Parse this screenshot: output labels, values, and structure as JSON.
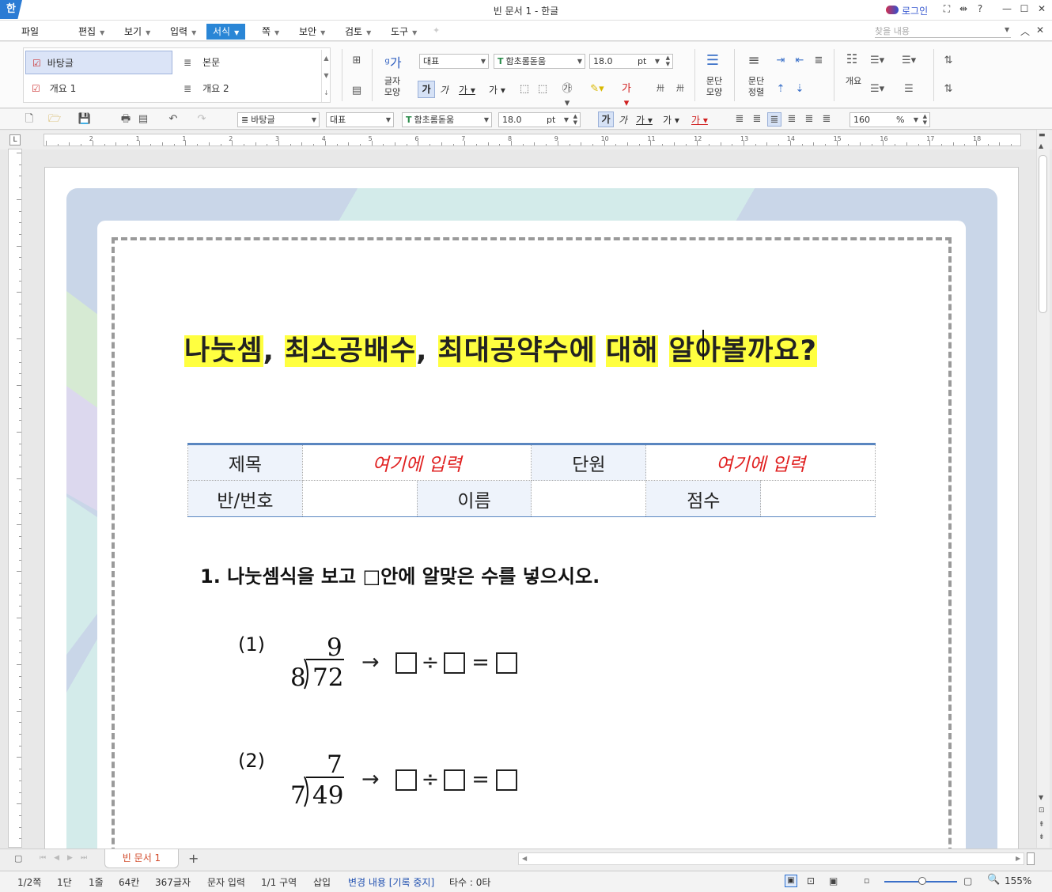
{
  "window": {
    "app_logo": "한",
    "title": "빈 문서 1 - 한글",
    "login": "로그인",
    "buttons": [
      "⛶",
      "⇹",
      "?",
      "—",
      "☐",
      "✕"
    ]
  },
  "menu": {
    "items": [
      "파일",
      "편집",
      "보기",
      "입력",
      "서식",
      "쪽",
      "보안",
      "검토",
      "도구"
    ],
    "active": "서식",
    "search_placeholder": "찾을 내용"
  },
  "ribbon": {
    "styles": [
      "바탕글",
      "본문",
      "개요 1",
      "개요 2"
    ],
    "char_shape_label": "글자 모양",
    "lang_value": "대표",
    "font_value": "함초롬돋움",
    "size_value": "18.0",
    "size_unit": "pt",
    "para_shape_label": "문단 모양",
    "para_align_label": "문단 정렬",
    "outline_label": "개요"
  },
  "toolbar": {
    "style_value": "바탕글",
    "lang_value": "대표",
    "font_value": "함초롬돋움",
    "size_value": "18.0",
    "size_unit": "pt",
    "zoom_value": "160",
    "zoom_unit": "%"
  },
  "ruler": {
    "numbers": [
      "2",
      "1",
      "1",
      "2",
      "3",
      "4",
      "5",
      "6",
      "7",
      "8",
      "9",
      "10",
      "11",
      "12",
      "13",
      "14",
      "15",
      "16",
      "17",
      "18"
    ]
  },
  "document": {
    "title_parts": [
      "나눗셈",
      ", ",
      "최소공배수",
      ", ",
      "최대공약수에",
      " ",
      "대해",
      " ",
      "알아볼까요?"
    ],
    "table": {
      "row1": {
        "h1": "제목",
        "v1": "여기에 입력",
        "h2": "단원",
        "v2": "여기에 입력"
      },
      "row2": {
        "h1": "반/번호",
        "h2": "이름",
        "h3": "점수"
      }
    },
    "question1": "1. 나눗셈식을 보고 □안에 알맞은 수를 넣으시오.",
    "problems": [
      {
        "label": "(1)",
        "quotient": "9",
        "divisor": "8",
        "dividend": "72",
        "arrow": "→",
        "div": "÷",
        "eq": "="
      },
      {
        "label": "(2)",
        "quotient": "7",
        "divisor": "7",
        "dividend": "49",
        "arrow": "→",
        "div": "÷",
        "eq": "="
      }
    ]
  },
  "tabs": {
    "doc_tab": "빈 문서 1",
    "add": "+"
  },
  "status": {
    "page": "1/2쪽",
    "column": "1단",
    "line": "1줄",
    "col": "64칸",
    "chars": "367글자",
    "mode": "문자 입력",
    "section": "1/1 구역",
    "insert": "삽입",
    "track": "변경 내용 [기록 중지]",
    "typing": "타수 : 0타",
    "zoom": "155%"
  }
}
